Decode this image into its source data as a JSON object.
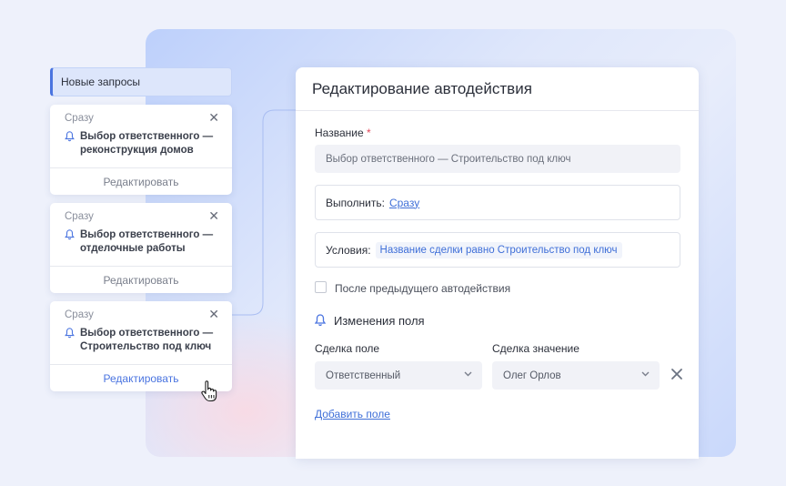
{
  "stage": {
    "title": "Новые запросы"
  },
  "cards": [
    {
      "when": "Сразу",
      "title": "Выбор ответственного — реконструкция домов",
      "edit_label": "Редактировать"
    },
    {
      "when": "Сразу",
      "title": "Выбор ответственного — отделочные работы",
      "edit_label": "Редактировать"
    },
    {
      "when": "Сразу",
      "title": "Выбор ответственного — Строительство под ключ",
      "edit_label": "Редактировать"
    }
  ],
  "panel": {
    "title": "Редактирование автодействия",
    "name_label": "Название",
    "name_required_mark": "*",
    "name_value": "Выбор ответственного — Строительство под ключ",
    "execute_label": "Выполнить:",
    "execute_value": "Сразу",
    "conditions_label": "Условия:",
    "conditions_value": "Название сделки равно Строительство под ключ",
    "after_previous_label": "После предыдущего автодействия",
    "section_title": "Изменения поля",
    "field_label": "Сделка поле",
    "value_label": "Сделка значение",
    "field_value": "Ответственный",
    "value_value": "Олег Орлов",
    "add_field_label": "Добавить поле"
  },
  "colors": {
    "accent": "#4a74e0",
    "link": "#3f6fd8",
    "required": "#e0485a"
  },
  "icons": {
    "bell": "bell-icon",
    "close": "close-icon",
    "chevron": "chevron-down-icon",
    "cursor": "hand-pointer-icon"
  }
}
